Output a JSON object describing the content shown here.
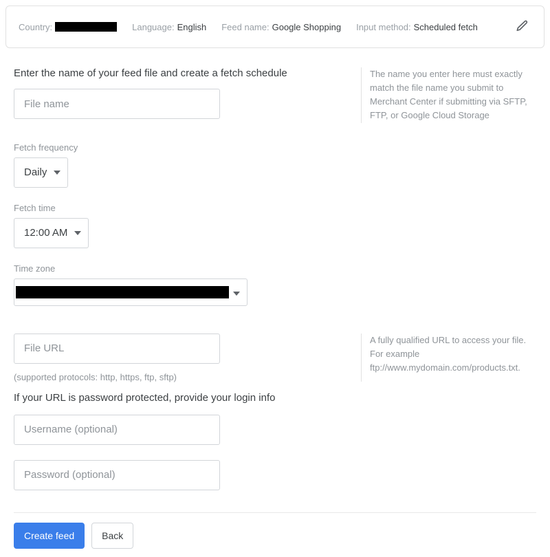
{
  "summary": {
    "country_label": "Country:",
    "country_value_redacted": true,
    "language_label": "Language:",
    "language_value": "English",
    "feed_name_label": "Feed name:",
    "feed_name_value": "Google Shopping",
    "input_method_label": "Input method:",
    "input_method_value": "Scheduled fetch"
  },
  "section1": {
    "heading": "Enter the name of your feed file and create a fetch schedule",
    "file_name_placeholder": "File name",
    "help": "The name you enter here must exactly match the file name you submit to Merchant Center if submitting via SFTP, FTP, or Google Cloud Storage"
  },
  "fields": {
    "fetch_frequency_label": "Fetch frequency",
    "fetch_frequency_value": "Daily",
    "fetch_time_label": "Fetch time",
    "fetch_time_value": "12:00 AM",
    "time_zone_label": "Time zone",
    "time_zone_value_redacted": true
  },
  "section2": {
    "file_url_placeholder": "File URL",
    "protocols_hint": "(supported protocols: http, https, ftp, sftp)",
    "help": "A fully qualified URL to access your file. For example ftp://www.mydomain.com/products.txt.",
    "password_section_heading": "If your URL is password protected, provide your login info",
    "username_placeholder": "Username (optional)",
    "password_placeholder": "Password (optional)"
  },
  "footer": {
    "primary": "Create feed",
    "secondary": "Back"
  }
}
